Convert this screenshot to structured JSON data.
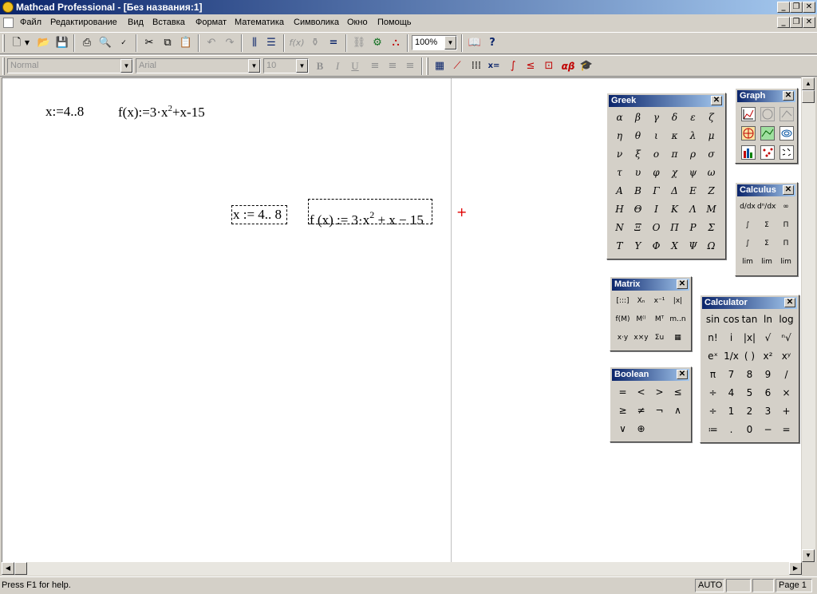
{
  "window": {
    "title": "Mathcad Professional - [Без названия:1]"
  },
  "menu": [
    "Файл",
    "Редактирование",
    "Вид",
    "Вставка",
    "Формат",
    "Математика",
    "Символика",
    "Окно",
    "Помощь"
  ],
  "toolbar": {
    "zoom": "100%"
  },
  "format_bar": {
    "style": "Normal",
    "font": "Arial",
    "size": "10",
    "bold": "B",
    "italic": "I",
    "underline": "U",
    "greek_toggle": "αβ",
    "eval_toggle": "x="
  },
  "worksheet": {
    "plain_range": "x:=4..8",
    "plain_func_base": "f(x):=3·x",
    "plain_func_exp": "2",
    "plain_func_rest": "+x-15",
    "range_expr": "x := 4.. 8",
    "func_base": "f (x) := 3·x",
    "func_exp": "2",
    "func_rest": " + x − 15",
    "cursor": "+"
  },
  "status": {
    "help": "Press F1 for help.",
    "mode": "AUTO",
    "page": "Page 1"
  },
  "palettes": {
    "greek": {
      "title": "Greek",
      "letters": [
        "α",
        "β",
        "γ",
        "δ",
        "ε",
        "ζ",
        "η",
        "θ",
        "ι",
        "κ",
        "λ",
        "μ",
        "ν",
        "ξ",
        "ο",
        "π",
        "ρ",
        "σ",
        "τ",
        "υ",
        "φ",
        "χ",
        "ψ",
        "ω",
        "Α",
        "Β",
        "Γ",
        "Δ",
        "Ε",
        "Ζ",
        "Η",
        "Θ",
        "Ι",
        "Κ",
        "Λ",
        "Μ",
        "Ν",
        "Ξ",
        "Ο",
        "Π",
        "Ρ",
        "Σ",
        "Τ",
        "Υ",
        "Φ",
        "Χ",
        "Ψ",
        "Ω"
      ]
    },
    "graph": {
      "title": "Graph"
    },
    "calculus": {
      "title": "Calculus",
      "items": [
        "d/dx",
        "dⁿ/dxⁿ",
        "∞",
        "∫",
        "Σ",
        "Π",
        "∫",
        "Σ",
        "Π",
        "lim",
        "lim",
        "lim"
      ]
    },
    "matrix": {
      "title": "Matrix",
      "items": [
        "[:::]",
        "Xₙ",
        "x⁻¹",
        "|x|",
        "f(M)",
        "M⁽⁾",
        "Mᵀ",
        "m..n",
        "x·y",
        "x×y",
        "Σu",
        "▦"
      ]
    },
    "boolean": {
      "title": "Boolean",
      "items": [
        "=",
        "<",
        ">",
        "≤",
        "≥",
        "≠",
        "¬",
        "∧",
        "∨",
        "⊕"
      ]
    },
    "calculator": {
      "title": "Calculator",
      "items": [
        "sin",
        "cos",
        "tan",
        "ln",
        "log",
        "n!",
        "i",
        "|x|",
        "√",
        "ⁿ√",
        "eˣ",
        "1/x",
        "( )",
        "x²",
        "xʸ",
        "π",
        "7",
        "8",
        "9",
        "/",
        "÷",
        "4",
        "5",
        "6",
        "×",
        "÷",
        "1",
        "2",
        "3",
        "+",
        "≔",
        ".",
        "0",
        "−",
        "="
      ]
    }
  }
}
